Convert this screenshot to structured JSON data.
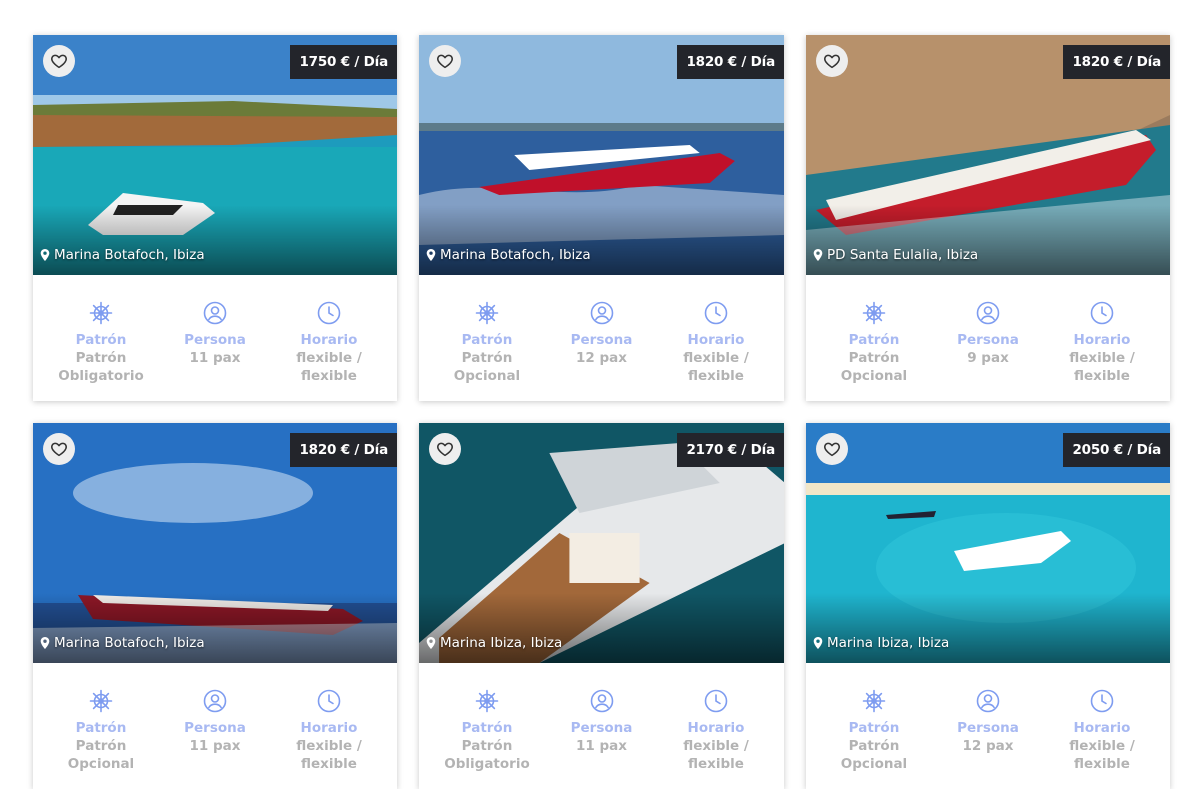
{
  "labels": {
    "skipper": "Patrón",
    "person": "Persona",
    "schedule": "Horario"
  },
  "boats": [
    {
      "price": "1750 € / Día",
      "location": "Marina Botafoch, Ibiza",
      "skipper_line1": "Patrón",
      "skipper_line2": "Obligatorio",
      "persons": "11 pax",
      "schedule_line1": "flexible /",
      "schedule_line2": "flexible"
    },
    {
      "price": "1820 € / Día",
      "location": "Marina Botafoch, Ibiza",
      "skipper_line1": "Patrón",
      "skipper_line2": "Opcional",
      "persons": "12 pax",
      "schedule_line1": "flexible /",
      "schedule_line2": "flexible"
    },
    {
      "price": "1820 € / Día",
      "location": "PD Santa Eulalia, Ibiza",
      "skipper_line1": "Patrón",
      "skipper_line2": "Opcional",
      "persons": "9 pax",
      "schedule_line1": "flexible /",
      "schedule_line2": "flexible"
    },
    {
      "price": "1820 € / Día",
      "location": "Marina Botafoch, Ibiza",
      "skipper_line1": "Patrón",
      "skipper_line2": "Opcional",
      "persons": "11 pax",
      "schedule_line1": "flexible /",
      "schedule_line2": "flexible"
    },
    {
      "price": "2170 € / Día",
      "location": "Marina Ibiza, Ibiza",
      "skipper_line1": "Patrón",
      "skipper_line2": "Obligatorio",
      "persons": "11 pax",
      "schedule_line1": "flexible /",
      "schedule_line2": "flexible"
    },
    {
      "price": "2050 € / Día",
      "location": "Marina Ibiza, Ibiza",
      "skipper_line1": "Patrón",
      "skipper_line2": "Opcional",
      "persons": "12 pax",
      "schedule_line1": "flexible /",
      "schedule_line2": "flexible"
    }
  ],
  "icons": {
    "favorite": "heart-icon",
    "location": "map-pin-icon",
    "skipper": "ship-wheel-icon",
    "person": "user-circle-icon",
    "schedule": "clock-icon"
  },
  "colors": {
    "accent": "#a8b9f2",
    "value_text": "#b3b3b3",
    "price_bg": "#23252b"
  }
}
